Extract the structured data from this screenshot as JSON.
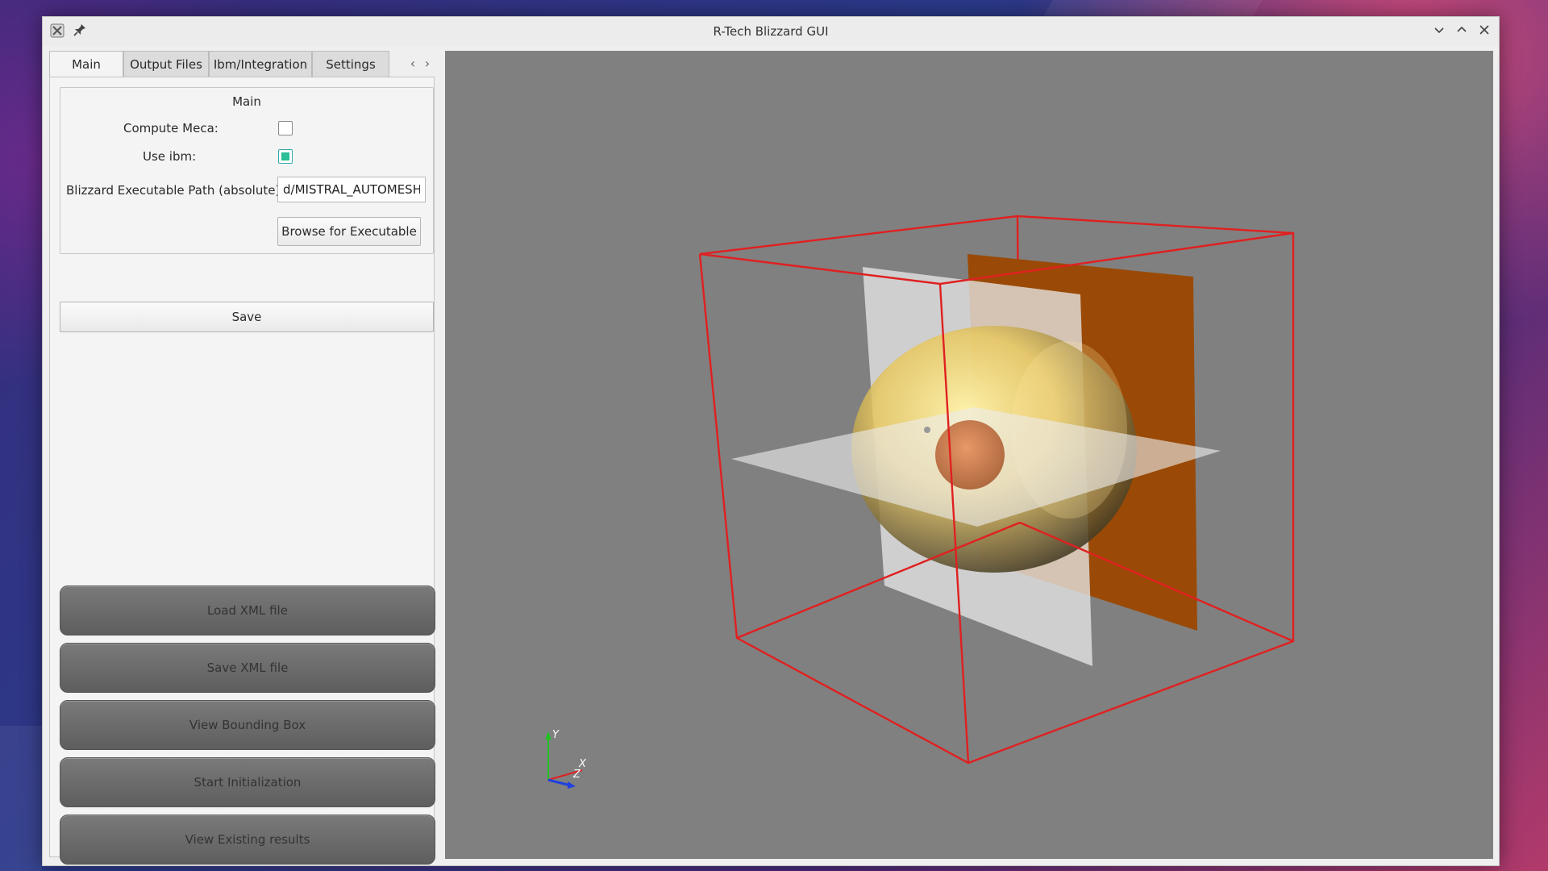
{
  "window": {
    "title": "R-Tech Blizzard GUI",
    "app_icon": "x-icon",
    "pin_icon": "pin-icon",
    "controls": [
      "chevron-down-icon",
      "chevron-up-icon",
      "close-icon"
    ]
  },
  "tabs": [
    {
      "label": "Main",
      "active": true
    },
    {
      "label": "Output Files",
      "active": false
    },
    {
      "label": "Ibm/Integration",
      "active": false
    },
    {
      "label": "Settings",
      "active": false
    }
  ],
  "tab_scroll": {
    "left": "‹",
    "right": "›"
  },
  "main_group": {
    "title": "Main",
    "compute_meca_label": "Compute Meca:",
    "compute_meca_checked": false,
    "use_ibm_label": "Use ibm:",
    "use_ibm_checked": true,
    "executable_path_label": "Blizzard Executable Path (absolute):",
    "executable_path_value": "d/MISTRAL_AUTOMESH",
    "browse_button": "Browse for Executable"
  },
  "save_button": "Save",
  "actions": [
    "Load XML file",
    "Save XML file",
    "View Bounding Box",
    "Start Initialization",
    "View Existing results"
  ],
  "viewport": {
    "background": "#808080",
    "box_color": "#e02020",
    "axes": {
      "x": "X",
      "y": "Y",
      "z": "Z"
    }
  }
}
